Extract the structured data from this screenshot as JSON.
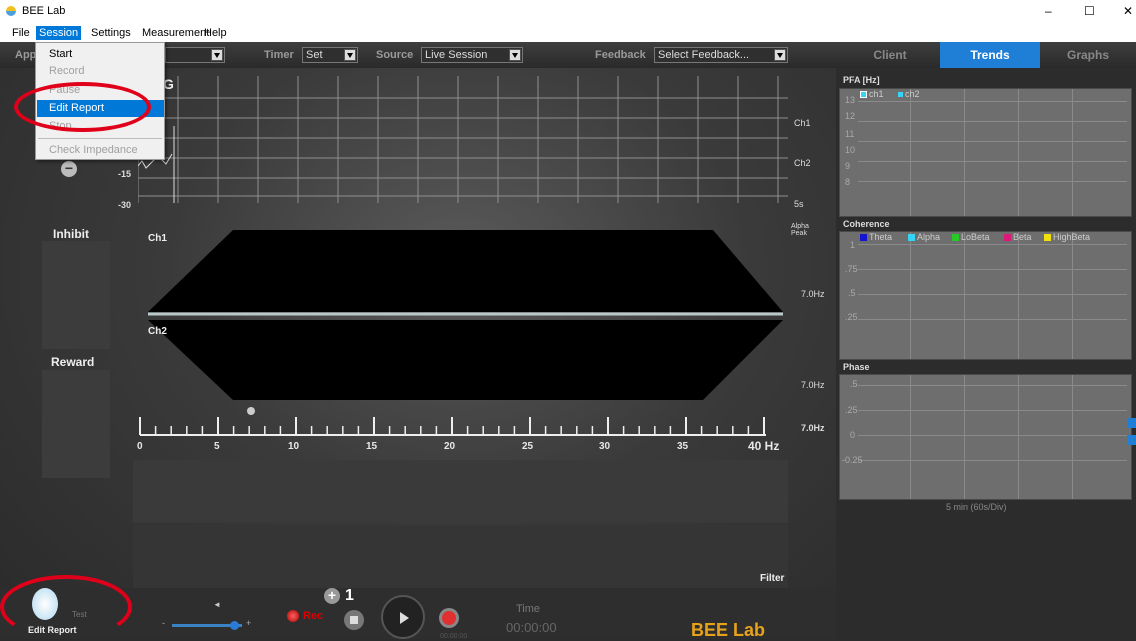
{
  "window": {
    "title": "BEE Lab",
    "min": "–",
    "max": "☐",
    "close": "✕"
  },
  "menubar": [
    "File",
    "Session",
    "Settings",
    "Measurement",
    "Help"
  ],
  "toolbar": {
    "app_label": "App",
    "timer_label": "Timer",
    "timer_value": "Set",
    "source_label": "Source",
    "source_value": "Live Session",
    "feedback_label": "Feedback",
    "feedback_value": "Select Feedback...",
    "tabs": [
      "Client",
      "Trends",
      "Graphs"
    ]
  },
  "session_menu": {
    "items": [
      {
        "label": "Start",
        "enabled": true
      },
      {
        "label": "Record",
        "enabled": false
      },
      {
        "label": "Pause",
        "enabled": false
      },
      {
        "label": "Edit Report",
        "enabled": true,
        "active": true
      },
      {
        "label": "Stop",
        "enabled": false
      },
      {
        "label": "Check Impedance",
        "enabled": false
      }
    ]
  },
  "eeg": {
    "title_fragment": "G",
    "ylabels": [
      "-15",
      "-30"
    ],
    "ch1": "Ch1",
    "ch2": "Ch2",
    "time": "5s"
  },
  "spectrum": {
    "ch1": "Ch1",
    "ch2": "Ch2",
    "alpha_peak": "Alpha\nPeak",
    "peak1": "7.0Hz",
    "peak2": "7.0Hz",
    "peak3": "7.0Hz",
    "scale": [
      "0",
      "5",
      "10",
      "15",
      "20",
      "25",
      "30",
      "35",
      "40 Hz"
    ]
  },
  "left": {
    "inhibit": "Inhibit",
    "reward": "Reward"
  },
  "filter": "Filter",
  "bottom": {
    "edit_report": "Edit Report",
    "test": "Test",
    "counter": "1",
    "rec": "Rec",
    "time_label": "Time",
    "time_value": "00:00:00",
    "small_time": "00:00:00",
    "brand": "BEE Lab"
  },
  "trends": {
    "pfa": {
      "title": "PFA [Hz]",
      "yticks": [
        "13",
        "12",
        "11",
        "10",
        "9",
        "8"
      ],
      "legend": [
        {
          "name": "ch1",
          "color": "#35d3f5"
        },
        {
          "name": "ch2",
          "color": "#35d3f5"
        }
      ]
    },
    "coherence": {
      "title": "Coherence",
      "yticks": [
        "1",
        ".75",
        ".5",
        ".25"
      ],
      "legend": [
        {
          "name": "Theta",
          "color": "#1515d0"
        },
        {
          "name": "Alpha",
          "color": "#35d3f5"
        },
        {
          "name": "LoBeta",
          "color": "#28c828"
        },
        {
          "name": "Beta",
          "color": "#e0187a"
        },
        {
          "name": "HighBeta",
          "color": "#f0e010"
        }
      ]
    },
    "phase": {
      "title": "Phase",
      "yticks": [
        ".5",
        ".25",
        "0",
        "-0.25"
      ]
    },
    "xaxis": "5 min (60s/Div)"
  }
}
